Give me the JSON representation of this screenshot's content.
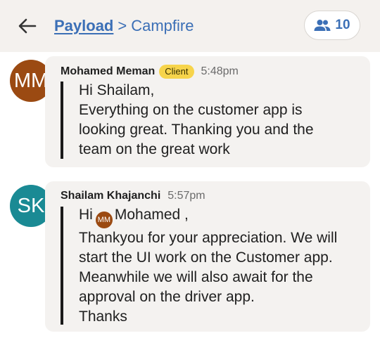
{
  "header": {
    "breadcrumb_parent": "Payload",
    "breadcrumb_separator": ">",
    "breadcrumb_current": "Campfire",
    "member_count": "10"
  },
  "messages": [
    {
      "avatar_initials": "MM",
      "avatar_color": "#9b4a12",
      "author": "Mohamed Meman",
      "badge": "Client",
      "time": "5:48pm",
      "lines": [
        "Hi Shailam,",
        "Everything on the customer app is",
        "looking great. Thanking you and the",
        "team on the great work"
      ]
    },
    {
      "avatar_initials": "SK",
      "avatar_color": "#1a8a94",
      "author": "Shailam Khajanchi",
      "time": "5:57pm",
      "greeting": "Hi",
      "mention_initials": "MM",
      "mention_name": "Mohamed ,",
      "lines": [
        "Thankyou for your appreciation. We will",
        "start the UI work on the Customer app.",
        "Meanwhile we will also await for the",
        "approval on the driver app.",
        "Thanks"
      ]
    }
  ],
  "icons": {
    "back": "arrow-left-icon",
    "members": "people-icon"
  }
}
